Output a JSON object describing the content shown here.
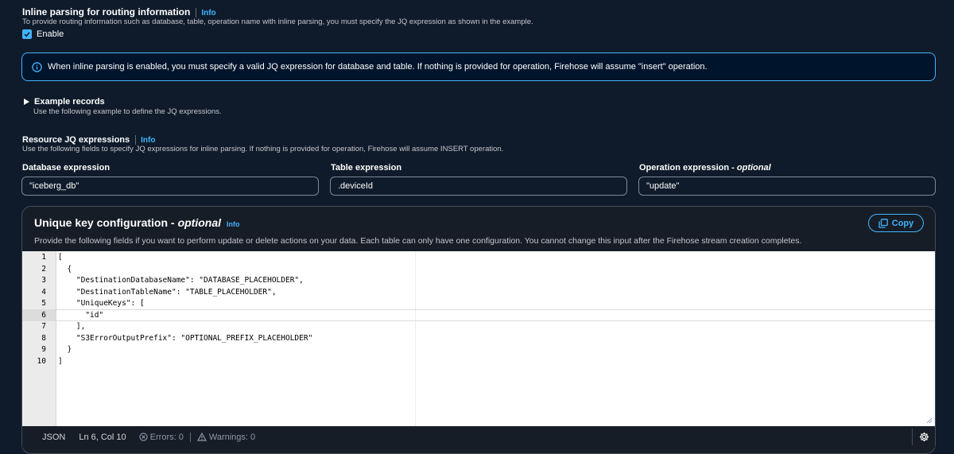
{
  "inline_parsing": {
    "title": "Inline parsing for routing information",
    "info": "Info",
    "description": "To provide routing information such as database, table, operation name with inline parsing, you must specify the JQ expression as shown in the example.",
    "enable_label": "Enable",
    "alert_text": "When inline parsing is enabled, you must specify a valid JQ expression for database and table. If nothing is provided for operation, Firehose will assume \"insert\" operation."
  },
  "example_records": {
    "title": "Example records",
    "description": "Use the following example to define the JQ expressions."
  },
  "resource_jq": {
    "title": "Resource JQ expressions",
    "info": "Info",
    "description": "Use the following fields to specify JQ expressions for inline parsing. If nothing is provided for operation, Firehose will assume INSERT operation.",
    "database_label": "Database expression",
    "database_value": "\"iceberg_db\"",
    "table_label": "Table expression",
    "table_value": ".deviceId",
    "operation_label": "Operation expression - ",
    "operation_optional": "optional",
    "operation_value": "\"update\""
  },
  "unique_key": {
    "title": "Unique key configuration - ",
    "title_optional": "optional",
    "info": "Info",
    "copy_label": "Copy",
    "description": "Provide the following fields if you want to perform update or delete actions on your data. Each table can only have one configuration. You cannot change this input after the Firehose stream creation completes.",
    "code_lines": [
      "[",
      "  {",
      "    \"DestinationDatabaseName\": \"DATABASE_PLACEHOLDER\",",
      "    \"DestinationTableName\": \"TABLE_PLACEHOLDER\",",
      "    \"UniqueKeys\": [",
      "      \"id\"",
      "    ],",
      "    \"S3ErrorOutputPrefix\": \"OPTIONAL_PREFIX_PLACEHOLDER\"",
      "  }",
      "]"
    ],
    "line_numbers": [
      "1",
      "2",
      "3",
      "4",
      "5",
      "6",
      "7",
      "8",
      "9",
      "10"
    ],
    "active_line": 6,
    "status": {
      "language": "JSON",
      "position": "Ln 6, Col 10",
      "errors": "Errors: 0",
      "warnings": "Warnings: 0"
    }
  },
  "colors": {
    "accent": "#42b4ff",
    "background": "#0f1b2a",
    "container": "#161d26"
  }
}
